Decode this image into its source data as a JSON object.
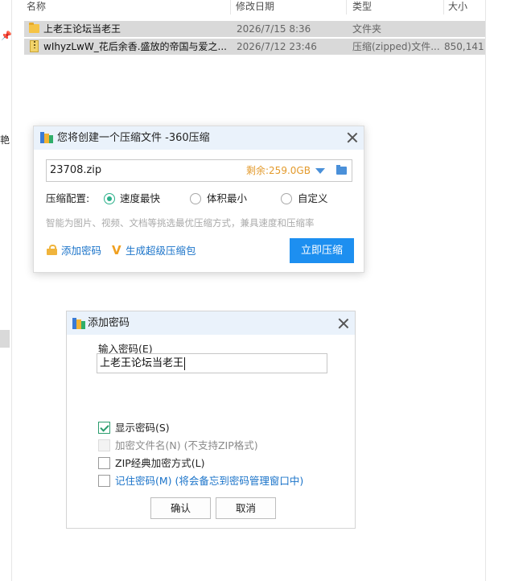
{
  "explorer": {
    "columns": [
      "名称",
      "修改日期",
      "类型",
      "大小"
    ],
    "sidebar_char": "艳",
    "files": [
      {
        "name": "上老王论坛当老王",
        "date": "2026/7/15 8:36",
        "type": "文件夹",
        "size": ""
      },
      {
        "name": "wIhyzLwW_花后余香.盛放的帝国与爱之...",
        "date": "2026/7/12 23:46",
        "type": "压缩(zipped)文件...",
        "size": "850,141"
      }
    ]
  },
  "compress_dialog": {
    "title": "您将创建一个压缩文件 -360压缩",
    "path_value": "23708.zip",
    "free_space": "剩余:259.0GB",
    "config_label": "压缩配置:",
    "options": [
      {
        "label": "速度最快",
        "selected": true
      },
      {
        "label": "体积最小",
        "selected": false
      },
      {
        "label": "自定义",
        "selected": false
      }
    ],
    "hint": "智能为图片、视频、文档等挑选最优压缩方式，兼具速度和压缩率",
    "add_password_link": "添加密码",
    "super_package_link": "生成超级压缩包",
    "compress_button": "立即压缩"
  },
  "password_dialog": {
    "title": "添加密码",
    "field_label": "输入密码(E)",
    "password_value": "上老王论坛当老王",
    "options": [
      {
        "label": "显示密码(S)",
        "checked": true,
        "disabled": false
      },
      {
        "label": "加密文件名(N) (不支持ZIP格式)",
        "checked": false,
        "disabled": true
      },
      {
        "label": "ZIP经典加密方式(L)",
        "checked": false,
        "disabled": false
      },
      {
        "label": "记住密码(M) (将会备忘到密码管理窗口中)",
        "checked": false,
        "disabled": false
      }
    ],
    "ok_button": "确认",
    "cancel_button": "取消"
  },
  "colors": {
    "accent_blue": "#1d8ff0",
    "free_space_orange": "#e39a2c",
    "radio_green": "#2bb08a",
    "titlebar": "#eaf2fb"
  }
}
